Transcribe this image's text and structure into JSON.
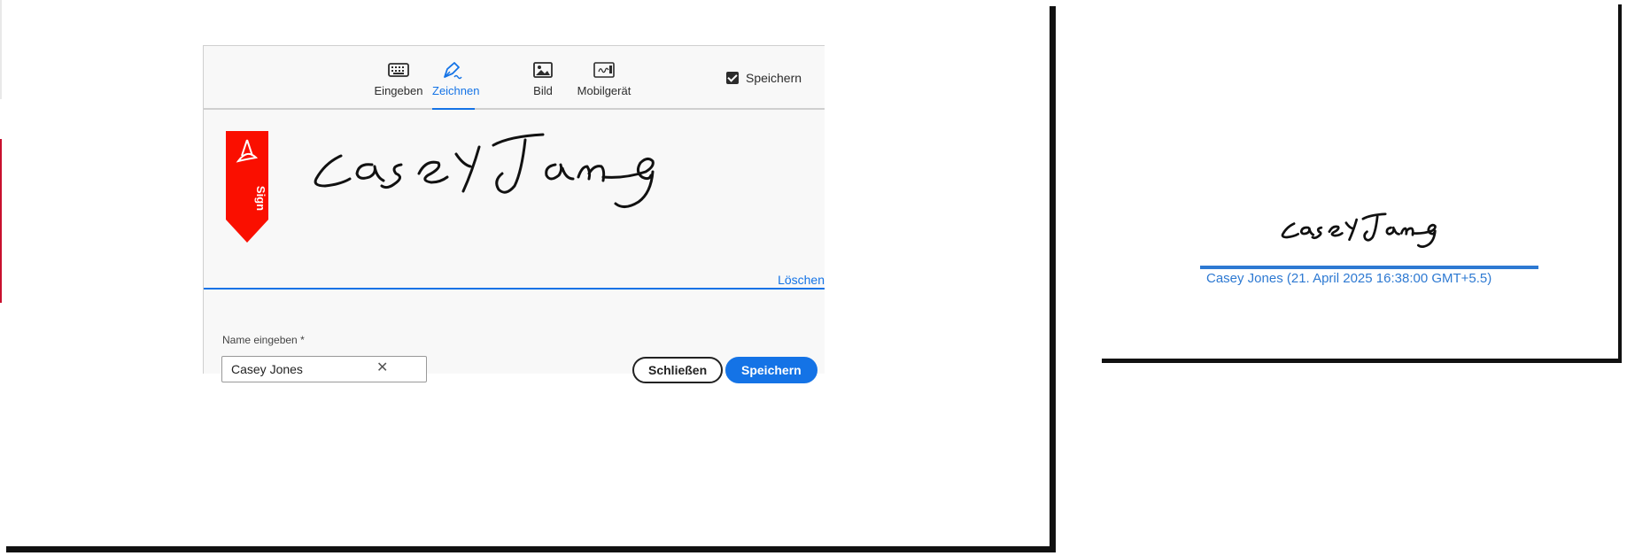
{
  "dialog": {
    "tabs": [
      {
        "label": "Eingeben",
        "icon": "keyboard-icon",
        "active": false
      },
      {
        "label": "Zeichnen",
        "icon": "pen-draw-icon",
        "active": true
      },
      {
        "label": "Bild",
        "icon": "image-icon",
        "active": false
      },
      {
        "label": "Mobilgerät",
        "icon": "mobile-device-icon",
        "active": false
      }
    ],
    "save_checkbox": {
      "label": "Speichern",
      "checked": true
    },
    "ribbon_text": "Sign",
    "clear_label": "Löschen",
    "name_label": "Name eingeben",
    "required_mark": "*",
    "name_value": "Casey Jones",
    "close_label": "Schließen",
    "save_label": "Speichern"
  },
  "preview": {
    "caption": "Casey Jones (21. April 2025 16:38:00 GMT+5.5)"
  },
  "colors": {
    "accent": "#1473e6",
    "ribbon": "#fa0f00",
    "preview_text": "#2d79d2"
  }
}
